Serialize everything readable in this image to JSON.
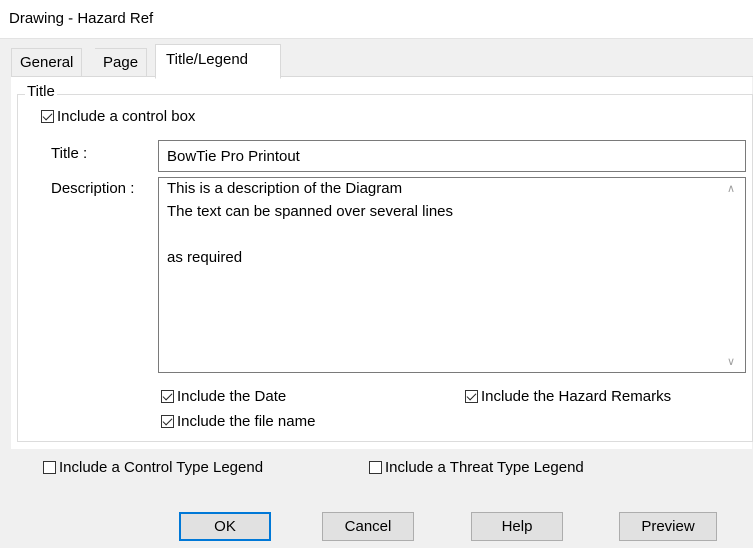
{
  "window": {
    "title": "Drawing - Hazard Ref"
  },
  "tabs": [
    {
      "label": "General",
      "active": false
    },
    {
      "label": "Page",
      "active": false
    },
    {
      "label": "Title/Legend",
      "active": true
    }
  ],
  "title_group": {
    "label": "Title",
    "include_control_box": {
      "label": "Include a control box",
      "checked": true
    },
    "title_field": {
      "label": "Title :",
      "value": "BowTie Pro Printout"
    },
    "description_field": {
      "label": "Description :",
      "lines": [
        "This is a description of the Diagram",
        "The text can be spanned over several lines",
        "",
        "as required"
      ]
    },
    "include_date": {
      "label": "Include the Date",
      "checked": true
    },
    "include_file_name": {
      "label": "Include the file name",
      "checked": true
    },
    "include_hazard_remarks": {
      "label": "Include the Hazard Remarks",
      "checked": true
    }
  },
  "legend_options": {
    "control_type_legend": {
      "label": "Include a Control Type Legend",
      "checked": false
    },
    "threat_type_legend": {
      "label": "Include a Threat Type Legend",
      "checked": false
    }
  },
  "buttons": {
    "ok": "OK",
    "cancel": "Cancel",
    "help": "Help",
    "preview": "Preview"
  },
  "icons": {
    "scroll_up": "chevron-up-icon",
    "scroll_down": "chevron-down-icon"
  },
  "colors": {
    "accent": "#0078d7",
    "background": "#f0f0f0",
    "panel": "#ffffff"
  }
}
